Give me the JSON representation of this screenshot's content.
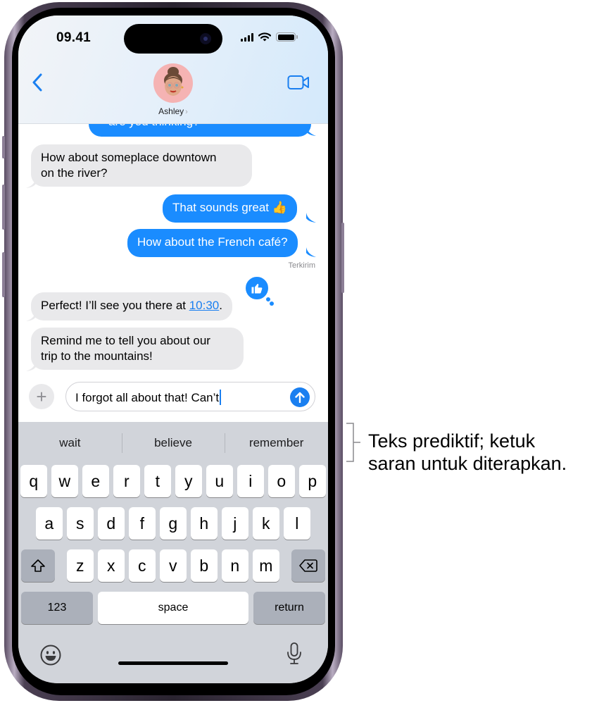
{
  "status_bar": {
    "time": "09.41",
    "signal_icon": "cellular-signal-icon",
    "wifi_icon": "wifi-icon",
    "battery_icon": "battery-icon"
  },
  "header": {
    "back_icon": "chevron-left-icon",
    "contact_name": "Ashley",
    "contact_chevron": "›",
    "video_icon": "video-camera-icon",
    "avatar": "memoji-avatar"
  },
  "messages": [
    {
      "direction": "out",
      "text": "are you thinking?"
    },
    {
      "direction": "in",
      "text_line1": "How about someplace downtown",
      "text_line2": "on the river?"
    },
    {
      "direction": "out",
      "text": "That sounds great",
      "emoji": "👍"
    },
    {
      "direction": "out",
      "text": "How about the French café?"
    },
    {
      "direction": "in",
      "text_before": "Perfect! I’ll see you there at ",
      "link": "10:30",
      "text_after": ".",
      "tapback": "thumbs-up"
    },
    {
      "direction": "in",
      "text_line1": "Remind me to tell you about our",
      "text_line2": "trip to the mountains!"
    }
  ],
  "delivery_status": "Terkirim",
  "composer": {
    "plus_label": "+",
    "value": "I forgot all about that! Can’t",
    "send_icon": "arrow-up-icon"
  },
  "keyboard": {
    "predictions": [
      "wait",
      "believe",
      "remember"
    ],
    "row1": [
      "q",
      "w",
      "e",
      "r",
      "t",
      "y",
      "u",
      "i",
      "o",
      "p"
    ],
    "row2": [
      "a",
      "s",
      "d",
      "f",
      "g",
      "h",
      "j",
      "k",
      "l"
    ],
    "row3": [
      "z",
      "x",
      "c",
      "v",
      "b",
      "n",
      "m"
    ],
    "shift_icon": "shift-icon",
    "delete_icon": "delete-icon",
    "numbers_label": "123",
    "space_label": "space",
    "return_label": "return",
    "emoji_icon": "emoji-icon",
    "mic_icon": "microphone-icon"
  },
  "callout": {
    "line1": "Teks prediktif; ketuk",
    "line2": "saran untuk diterapkan."
  },
  "colors": {
    "accent_blue": "#1a8cff",
    "incoming_bubble": "#e9e9eb",
    "keyboard_bg": "#d1d4da"
  }
}
